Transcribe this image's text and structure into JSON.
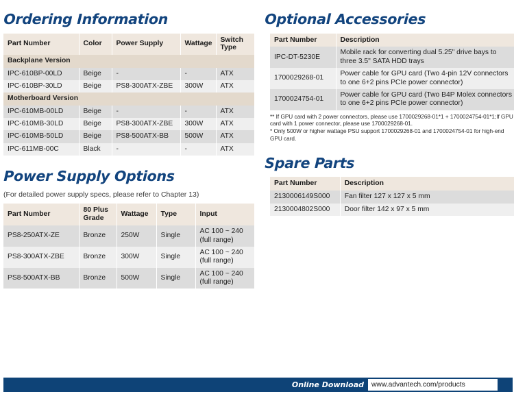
{
  "ordering": {
    "title": "Ordering Information",
    "columns": [
      "Part Number",
      "Color",
      "Power Supply",
      "Wattage",
      "Switch Type"
    ],
    "groups": [
      {
        "label": "Backplane Version",
        "rows": [
          {
            "part": "IPC-610BP-00LD",
            "color": "Beige",
            "psu": "-",
            "wattage": "-",
            "switch": "ATX"
          },
          {
            "part": "IPC-610BP-30LD",
            "color": "Beige",
            "psu": "PS8-300ATX-ZBE",
            "wattage": "300W",
            "switch": "ATX"
          }
        ]
      },
      {
        "label": "Motherboard Version",
        "rows": [
          {
            "part": "IPC-610MB-00LD",
            "color": "Beige",
            "psu": "-",
            "wattage": "-",
            "switch": "ATX"
          },
          {
            "part": "IPC-610MB-30LD",
            "color": "Beige",
            "psu": "PS8-300ATX-ZBE",
            "wattage": "300W",
            "switch": "ATX"
          },
          {
            "part": "IPC-610MB-50LD",
            "color": "Beige",
            "psu": "PS8-500ATX-BB",
            "wattage": "500W",
            "switch": "ATX"
          },
          {
            "part": "IPC-611MB-00C",
            "color": "Black",
            "psu": "-",
            "wattage": "-",
            "switch": "ATX"
          }
        ]
      }
    ]
  },
  "power_supply": {
    "title": "Power Supply Options",
    "subtitle": "(For detailed power supply specs, please refer to Chapter 13)",
    "columns": [
      "Part Number",
      "80 Plus Grade",
      "Wattage",
      "Type",
      "Input"
    ],
    "rows": [
      {
        "part": "PS8-250ATX-ZE",
        "grade": "Bronze",
        "wattage": "250W",
        "type": "Single",
        "input": "AC 100 ~ 240 (full range)"
      },
      {
        "part": "PS8-300ATX-ZBE",
        "grade": "Bronze",
        "wattage": "300W",
        "type": "Single",
        "input": "AC 100 ~ 240 (full range)"
      },
      {
        "part": "PS8-500ATX-BB",
        "grade": "Bronze",
        "wattage": "500W",
        "type": "Single",
        "input": "AC 100 ~ 240 (full range)"
      }
    ]
  },
  "accessories": {
    "title": "Optional Accessories",
    "columns": [
      "Part Number",
      "Description"
    ],
    "rows": [
      {
        "part": "IPC-DT-5230E",
        "desc": "Mobile rack for converting dual 5.25\" drive bays to three 3.5\" SATA HDD trays"
      },
      {
        "part": "1700029268-01",
        "desc": "Power cable for GPU card (Two 4-pin 12V connectors to one 6+2 pins PCIe power connector)"
      },
      {
        "part": "1700024754-01",
        "desc": "Power cable for GPU card (Two B4P Molex connectors to one 6+2 pins PCIe power connector)"
      }
    ],
    "footnotes": [
      "** If GPU card with 2 power connectors, please use 1700029268-01*1 + 1700024754-01*1;If GPU card with 1 power connector, please use 1700029268-01.",
      "* Only 500W or higher wattage PSU support 1700029268-01 and 1700024754-01 for high-end GPU card."
    ]
  },
  "spare_parts": {
    "title": "Spare Parts",
    "columns": [
      "Part Number",
      "Description"
    ],
    "rows": [
      {
        "part": "2130006149S000",
        "desc": "Fan filter 127 x 127 x 5 mm"
      },
      {
        "part": "2130004802S000",
        "desc": "Door filter 142 x 97 x 5 mm"
      }
    ]
  },
  "footer": {
    "label": "Online Download",
    "url": "www.advantech.com/products",
    "bar_color": "#0e4377"
  },
  "theme": {
    "heading_color": "#12447e",
    "table_header_bg": "#efe7de",
    "group_row_bg": "#e3d9cc",
    "row_odd_bg": "#dcdcdc",
    "row_even_bg": "#efefef"
  }
}
